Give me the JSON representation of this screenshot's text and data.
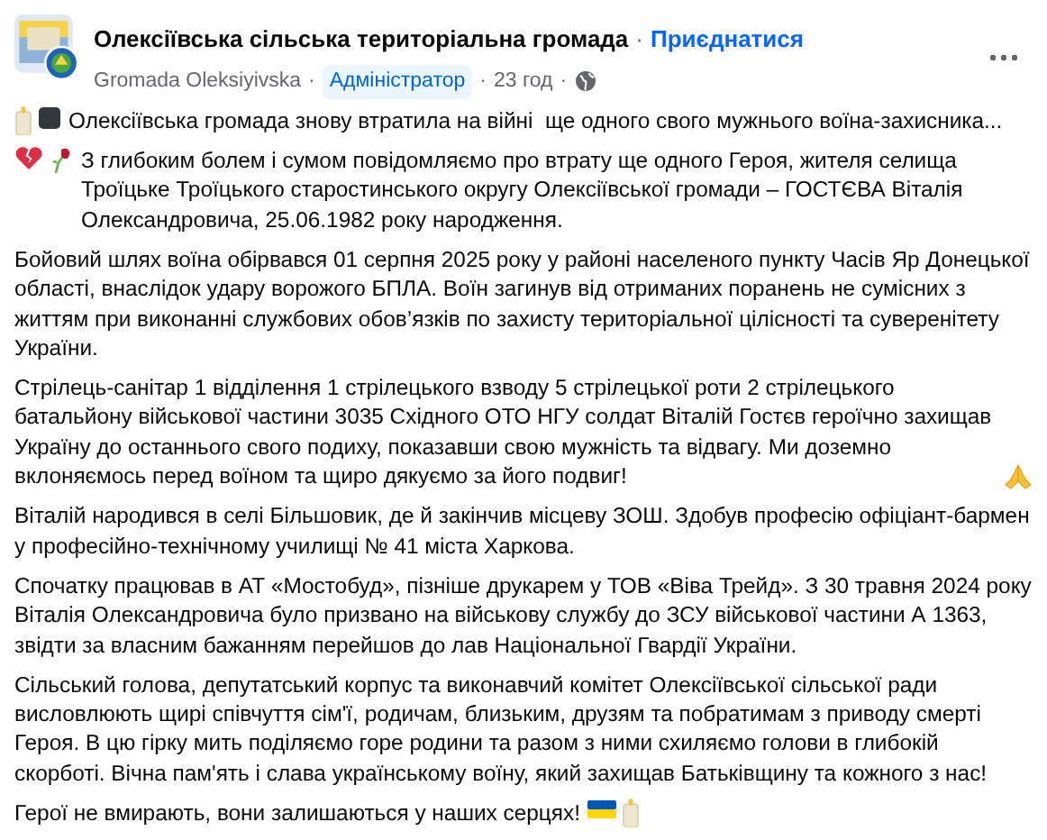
{
  "post": {
    "page_name": "Олексіївська сільська територіальна громада",
    "separator": "·",
    "join_link": "Приєднатися",
    "author": "Gromada Oleksiyivska",
    "role_badge": "Адміністратор",
    "time": "23 год",
    "paragraphs": [
      {
        "text": "Олексіївська громада знову втратила на війні  ще одного свого мужнього воїна-захисника..."
      },
      {
        "text": "З глибоким болем і сумом повідомляємо про втрату ще одного Героя, жителя селища Троїцьке Троїцького старостинського округу Олексіївської громади – ГОСТЄВА Віталія Олександровича, 25.06.1982 року народження."
      },
      {
        "text": "Бойовий шлях воїна обірвався 01 серпня 2025 року у районі населеного пункту Часів Яр Донецької області, внаслідок удару ворожого БПЛА. Воїн загинув від отриманих поранень не сумісних з життям при виконанні службових обов’язків по захисту територіальної цілісності та суверенітету України."
      },
      {
        "text": "Стрілець-санітар 1 відділення 1 стрілецького взводу 5 стрілецької роти 2 стрілецького батальйону військової частини 3035 Східного ОТО НГУ солдат Віталій Гостєв героїчно захищав Україну до останнього свого подиху, показавши свою мужність та відвагу. Ми доземно вклоняємось перед воїном та щиро дякуємо за його подвиг!"
      },
      {
        "text": "Віталій народився в селі Більшовик, де й закінчив місцеву ЗОШ. Здобув професію офіціант-бармен у професійно-технічному училищі № 41 міста Харкова."
      },
      {
        "text": "Спочатку працював в АТ «Мостобуд», пізніше друкарем у ТОВ «Віва Трейд». З 30 травня 2024 року Віталія Олександровича було призвано на військову службу до ЗСУ військової частини А 1363, звідти за власним бажанням перейшов до лав Національної Гвардії України."
      },
      {
        "text": "Сільський голова, депутатський корпус та виконавчий комітет Олексіївської сільської ради висловлюють щирі співчуття сім'ї, родичам, близьким, друзям та побратимам з приводу смерті Героя. В цю гірку мить поділяємо горе родини та разом з ними схиляємо голови в глибокій скорботі. Вічна пам'ять і слава українському воїну, який захищав Батьківщину та кожного з нас!"
      },
      {
        "text": "Герої не вмирають, вони залишаються у наших серцях!"
      }
    ]
  }
}
